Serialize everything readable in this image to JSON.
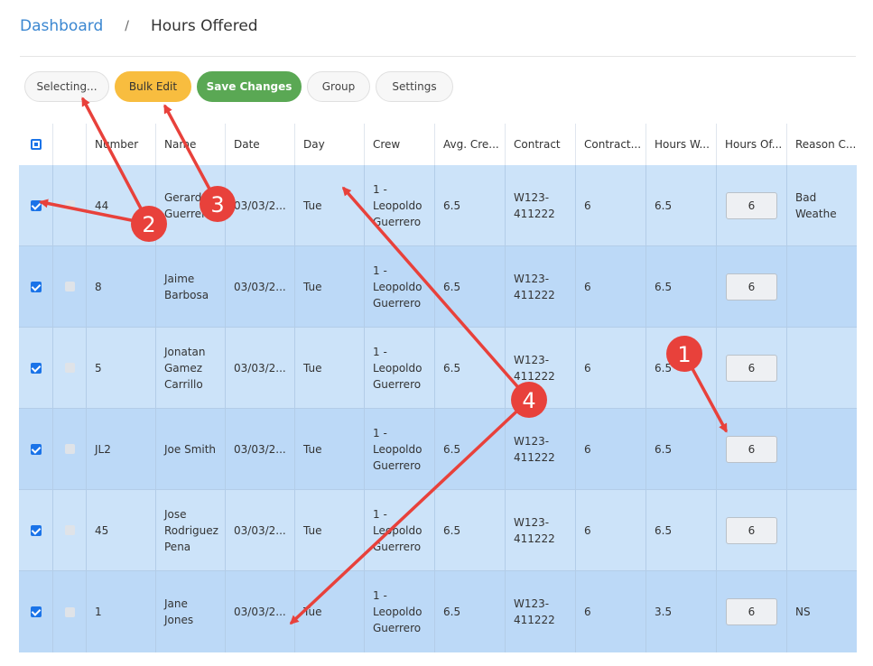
{
  "breadcrumb": {
    "root": "Dashboard",
    "separator": "/",
    "current": "Hours Offered"
  },
  "toolbar": {
    "selecting": "Selecting...",
    "bulk_edit": "Bulk Edit",
    "save_changes": "Save Changes",
    "group": "Group",
    "settings": "Settings"
  },
  "table": {
    "headers": [
      "Number",
      "Name",
      "Date",
      "Day",
      "Crew",
      "Avg. Cre...",
      "Contract",
      "Contract...",
      "Hours W...",
      "Hours Of...",
      "Reason C..."
    ],
    "rows": [
      {
        "checked": true,
        "number": "44",
        "name": "Gerardo Guerrero",
        "date": "03/03/2...",
        "day": "Tue",
        "crew": "1 - Leopoldo Guerrero",
        "avg_crew": "6.5",
        "contract": "W123-411222",
        "contract_hours": "6",
        "hours_worked": "6.5",
        "hours_offered": "6",
        "reason": "Bad Weathe"
      },
      {
        "checked": true,
        "number": "8",
        "name": "Jaime Barbosa",
        "date": "03/03/2...",
        "day": "Tue",
        "crew": "1 - Leopoldo Guerrero",
        "avg_crew": "6.5",
        "contract": "W123-411222",
        "contract_hours": "6",
        "hours_worked": "6.5",
        "hours_offered": "6",
        "reason": ""
      },
      {
        "checked": true,
        "number": "5",
        "name": "Jonatan Gamez Carrillo",
        "date": "03/03/2...",
        "day": "Tue",
        "crew": "1 - Leopoldo Guerrero",
        "avg_crew": "6.5",
        "contract": "W123-411222",
        "contract_hours": "6",
        "hours_worked": "6.5",
        "hours_offered": "6",
        "reason": ""
      },
      {
        "checked": true,
        "number": "JL2",
        "name": "Joe Smith",
        "date": "03/03/2...",
        "day": "Tue",
        "crew": "1 - Leopoldo Guerrero",
        "avg_crew": "6.5",
        "contract": "W123-411222",
        "contract_hours": "6",
        "hours_worked": "6.5",
        "hours_offered": "6",
        "reason": ""
      },
      {
        "checked": true,
        "number": "45",
        "name": "Jose Rodriguez Pena",
        "date": "03/03/2...",
        "day": "Tue",
        "crew": "1 - Leopoldo Guerrero",
        "avg_crew": "6.5",
        "contract": "W123-411222",
        "contract_hours": "6",
        "hours_worked": "6.5",
        "hours_offered": "6",
        "reason": ""
      },
      {
        "checked": true,
        "number": "1",
        "name": "Jane Jones",
        "date": "03/03/2...",
        "day": "Tue",
        "crew": "1 - Leopoldo Guerrero",
        "avg_crew": "6.5",
        "contract": "W123-411222",
        "contract_hours": "6",
        "hours_worked": "3.5",
        "hours_offered": "6",
        "reason": "NS"
      }
    ]
  },
  "annotations": {
    "color": "#e8413b",
    "badges": [
      "1",
      "2",
      "3",
      "4"
    ]
  }
}
